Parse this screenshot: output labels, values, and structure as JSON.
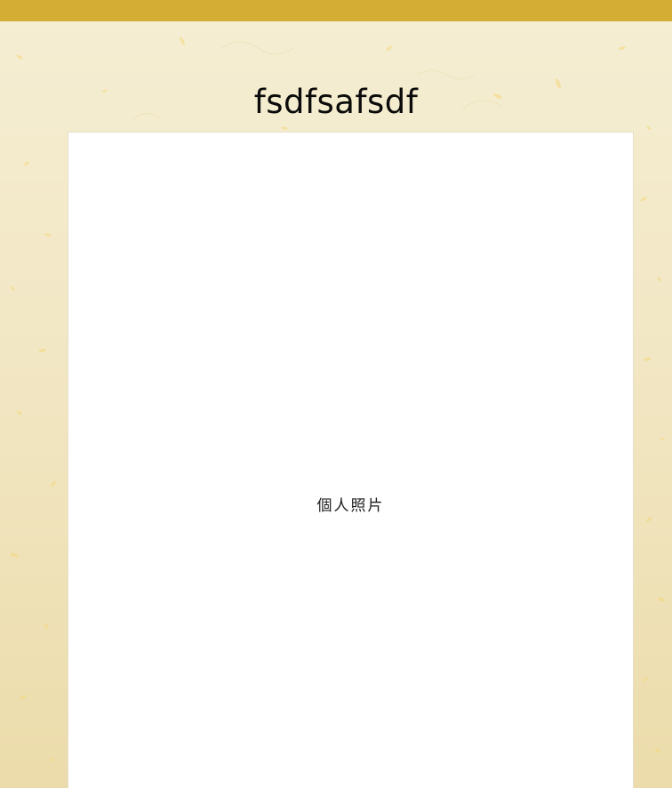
{
  "page": {
    "title": "fsdfsafsdf",
    "photo_placeholder": "個人照片"
  },
  "theme": {
    "top_bar_color": "#d4ad35",
    "background_color": "#f2e7c4",
    "speckle_color": "#f3d77a",
    "frame_color": "#ffffff"
  }
}
